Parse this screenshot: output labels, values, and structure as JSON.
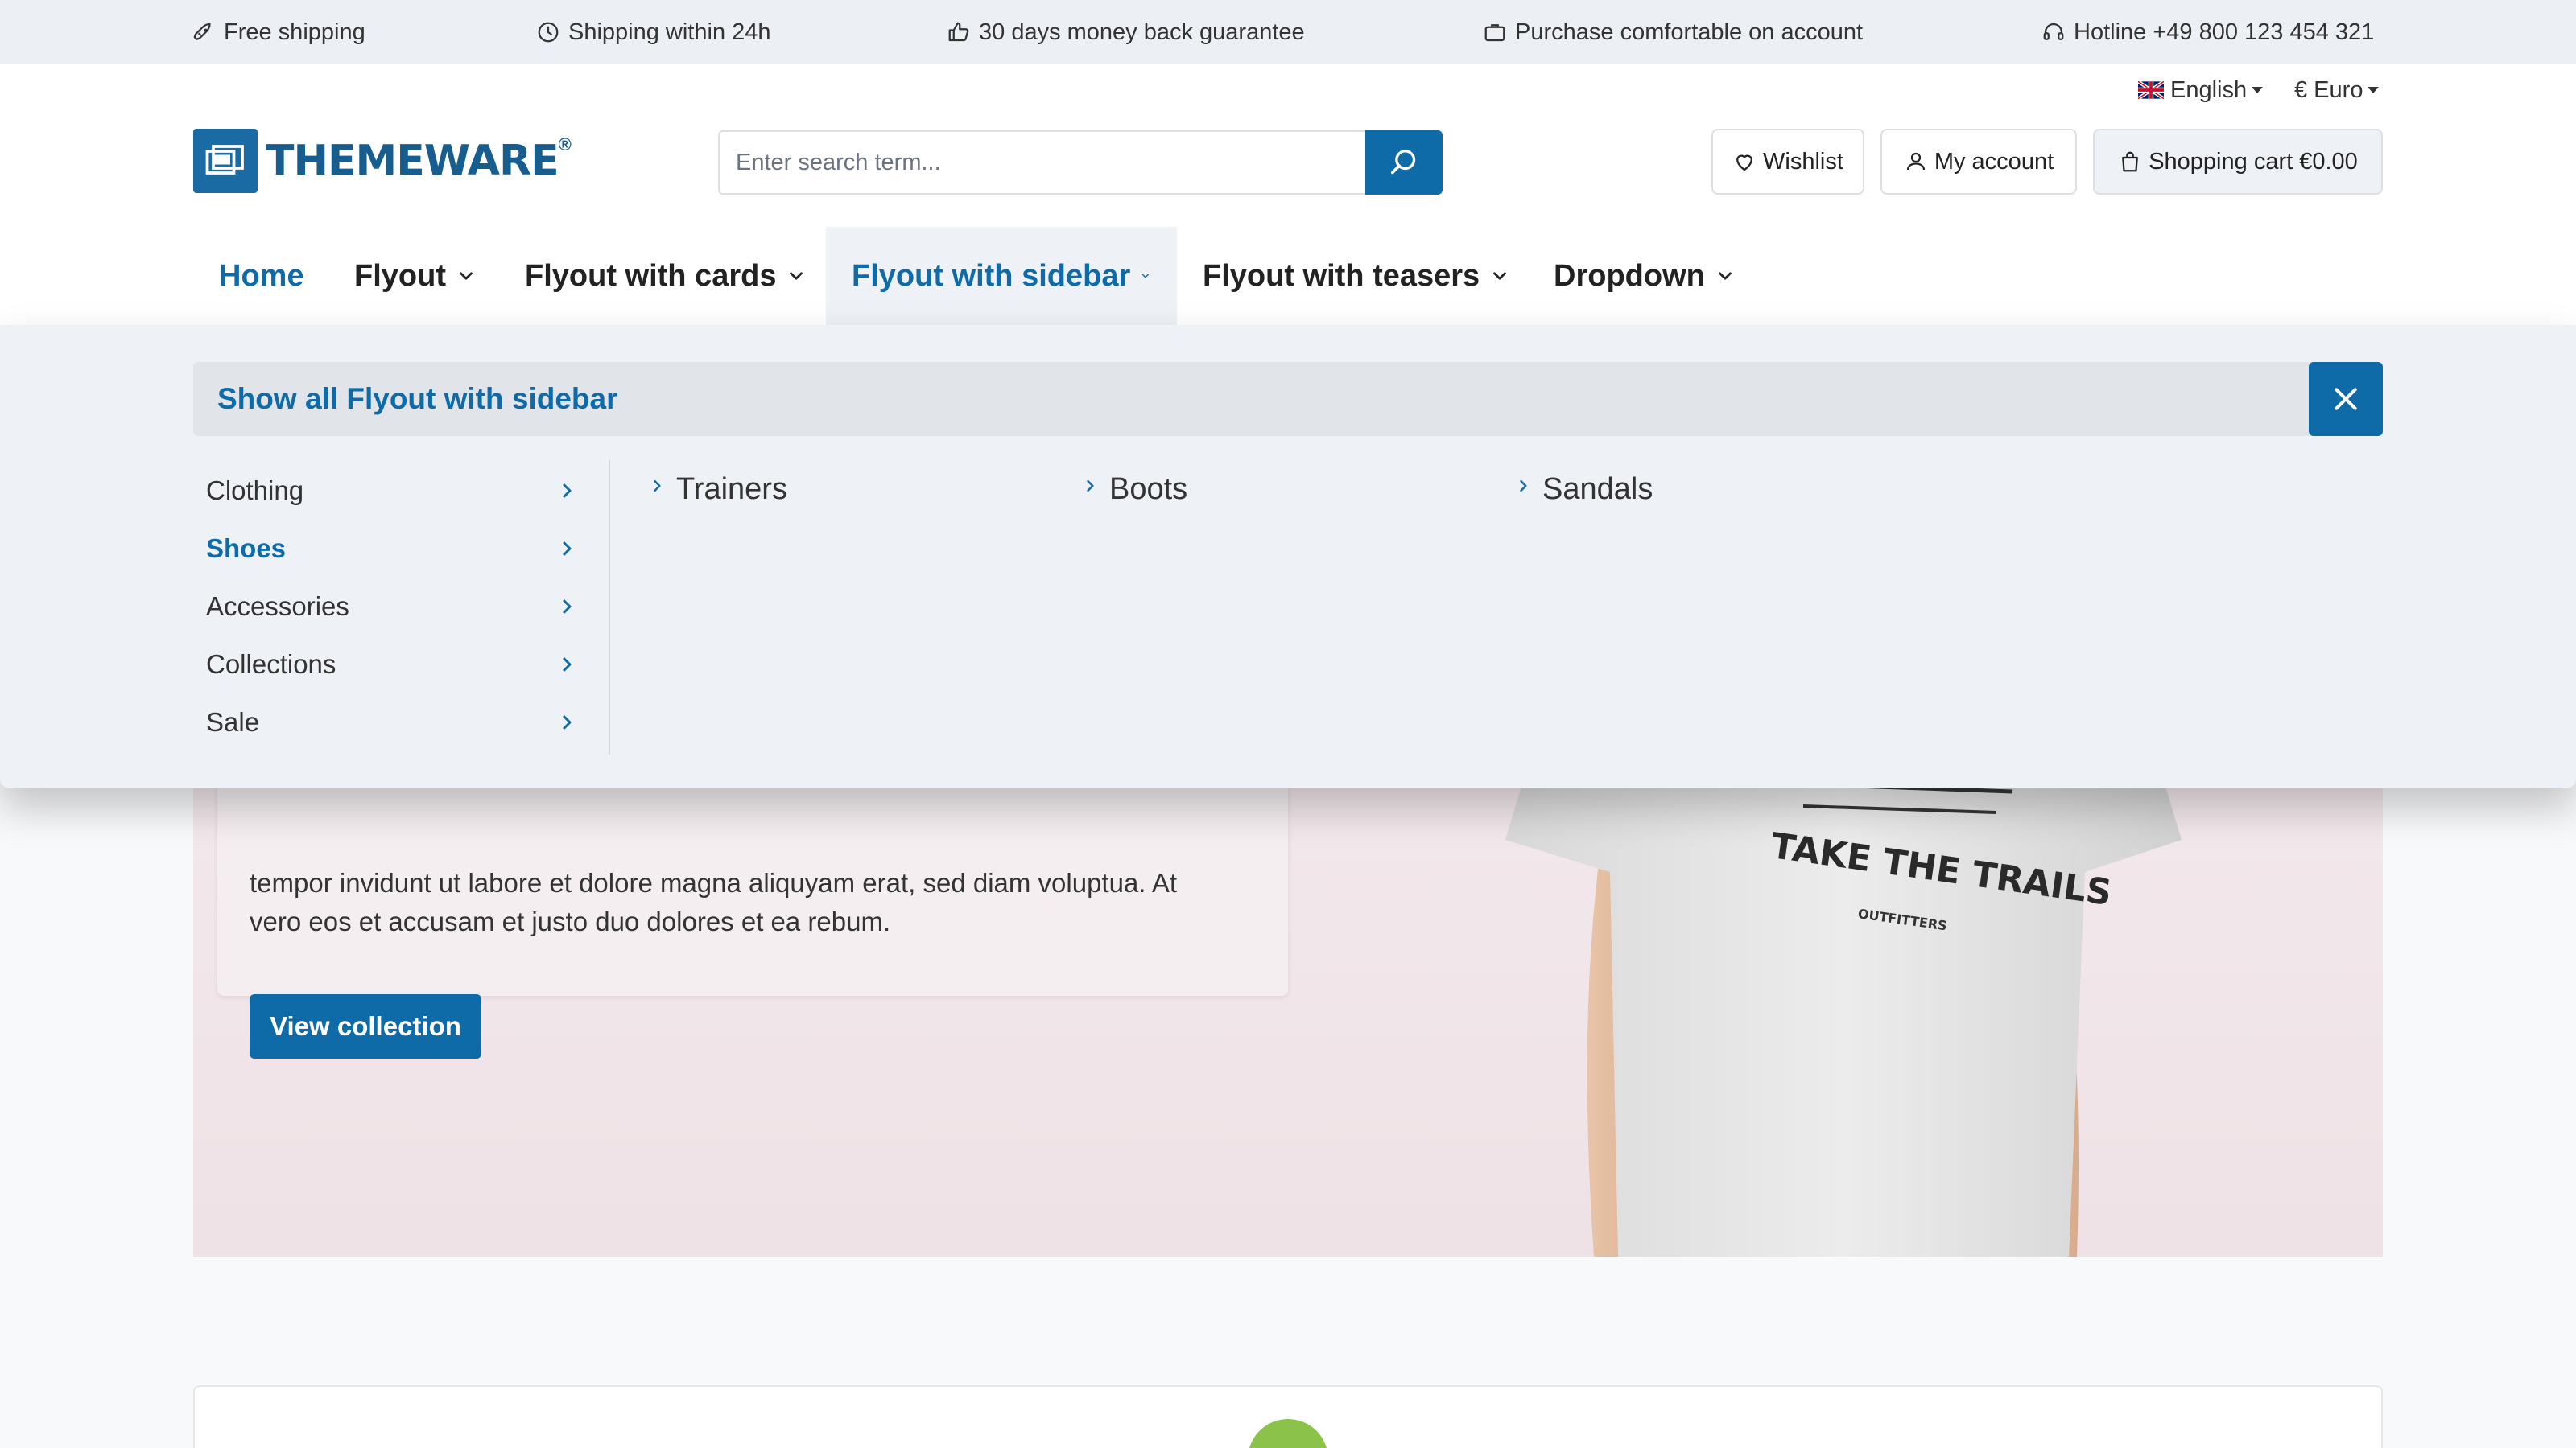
{
  "topbar": {
    "usps": [
      {
        "label": "Free shipping",
        "icon": "rocket-icon"
      },
      {
        "label": "Shipping within 24h",
        "icon": "clock-icon"
      },
      {
        "label": "30 days money back guarantee",
        "icon": "thumbs-up-icon"
      },
      {
        "label": "Purchase comfortable on account",
        "icon": "briefcase-icon"
      },
      {
        "label": "Hotline +49 800 123 454 321",
        "icon": "headset-icon"
      }
    ]
  },
  "header": {
    "language": "English",
    "currency": "€ Euro",
    "logo_text": "THEMEWARE",
    "logo_reg": "®",
    "search_placeholder": "Enter search term...",
    "wishlist_label": "Wishlist",
    "account_label": "My account",
    "cart_label": "Shopping cart €0.00"
  },
  "nav": {
    "items": [
      {
        "label": "Home"
      },
      {
        "label": "Flyout"
      },
      {
        "label": "Flyout with cards"
      },
      {
        "label": "Flyout with sidebar"
      },
      {
        "label": "Flyout with teasers"
      },
      {
        "label": "Dropdown"
      }
    ]
  },
  "flyout": {
    "title": "Show all Flyout with sidebar",
    "sidebar": [
      {
        "label": "Clothing"
      },
      {
        "label": "Shoes"
      },
      {
        "label": "Accessories"
      },
      {
        "label": "Collections"
      },
      {
        "label": "Sale"
      }
    ],
    "subcategories": [
      {
        "label": "Trainers"
      },
      {
        "label": "Boots"
      },
      {
        "label": "Sandals"
      }
    ]
  },
  "hero": {
    "text_line1": "tempor invidunt ut labore et dolore magna aliquyam erat, sed diam voluptua. At",
    "text_line2": "vero eos et accusam et justo duo dolores et ea rebum.",
    "button_label": "View collection",
    "shirt_print_main": "TAKE THE TRAILS",
    "shirt_print_sub": "OUTFITTERS"
  },
  "colors": {
    "primary": "#0f6ba8",
    "topbar_bg": "#eceff3",
    "flyout_bg": "#eef1f5",
    "hero_bg": "#efe2e6"
  }
}
